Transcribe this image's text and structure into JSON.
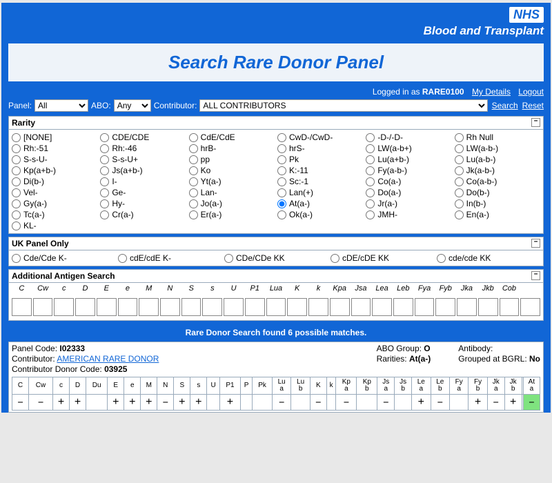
{
  "brand": {
    "logo": "NHS",
    "subtitle": "Blood and Transplant"
  },
  "page_title": "Search Rare Donor Panel",
  "user": {
    "prefix": "Logged in as ",
    "name": "RARE0100",
    "details": "My Details",
    "logout": "Logout"
  },
  "filter": {
    "panel_lbl": "Panel:",
    "panel_val": "All",
    "abo_lbl": "ABO:",
    "abo_val": "Any",
    "contrib_lbl": "Contributor:",
    "contrib_val": "ALL CONTRIBUTORS",
    "search": "Search",
    "reset": "Reset"
  },
  "rarity": {
    "title": "Rarity",
    "items": [
      "[NONE]",
      "CDE/CDE",
      "CdE/CdE",
      "CwD-/CwD-",
      "-D-/-D-",
      "Rh Null",
      "Rh:-51",
      "Rh:-46",
      "hrB-",
      "hrS-",
      "LW(a-b+)",
      "LW(a-b-)",
      "S-s-U-",
      "S-s-U+",
      "pp",
      "Pk",
      "Lu(a+b-)",
      "Lu(a-b-)",
      "Kp(a+b-)",
      "Js(a+b-)",
      "Ko",
      "K:-11",
      "Fy(a-b-)",
      "Jk(a-b-)",
      "Di(b-)",
      "I-",
      "Yt(a-)",
      "Sc:-1",
      "Co(a-)",
      "Co(a-b-)",
      "Vel-",
      "Ge-",
      "Lan-",
      "Lan(+)",
      "Do(a-)",
      "Do(b-)",
      "Gy(a-)",
      "Hy-",
      "Jo(a-)",
      "At(a-)",
      "Jr(a-)",
      "In(b-)",
      "Tc(a-)",
      "Cr(a-)",
      "Er(a-)",
      "Ok(a-)",
      "JMH-",
      "En(a-)",
      "KL-"
    ],
    "selected": "At(a-)"
  },
  "uk": {
    "title": "UK Panel Only",
    "items": [
      "Cde/Cde K-",
      "cdE/cdE K-",
      "CDe/CDe KK",
      "cDE/cDE KK",
      "cde/cde KK"
    ]
  },
  "antigen": {
    "title": "Additional Antigen Search",
    "cols": [
      "C",
      "Cw",
      "c",
      "D",
      "E",
      "e",
      "M",
      "N",
      "S",
      "s",
      "U",
      "P1",
      "Lua",
      "K",
      "k",
      "Kpa",
      "Jsa",
      "Lea",
      "Leb",
      "Fya",
      "Fyb",
      "Jka",
      "Jkb",
      "Cob",
      ""
    ]
  },
  "results": {
    "msg": "Rare Donor Search found 6 possible matches.",
    "entry": {
      "panel_code_lbl": "Panel Code: ",
      "panel_code": "I02333",
      "contributor_lbl": "Contributor: ",
      "contributor": "AMERICAN RARE DONOR",
      "cdonor_lbl": "Contributor Donor Code: ",
      "cdonor": "03925",
      "abo_lbl": "ABO Group: ",
      "abo": "O",
      "rar_lbl": "Rarities: ",
      "rar": "At(a-)",
      "ab_lbl": "Antibody:",
      "ab": "",
      "grp_lbl": "Grouped at BGRL: ",
      "grp": "No"
    },
    "cols": [
      "C",
      "Cw",
      "c",
      "D",
      "Du",
      "E",
      "e",
      "M",
      "N",
      "S",
      "s",
      "U",
      "P1",
      "P",
      "Pk",
      "Lu a",
      "Lu b",
      "K",
      "k",
      "Kp a",
      "Kp b",
      "Js a",
      "Js b",
      "Le a",
      "Le b",
      "Fy a",
      "Fy b",
      "Jk a",
      "Jk b",
      "",
      "At a"
    ],
    "vals": [
      "–",
      "–",
      "+",
      "+",
      "",
      "+",
      "+",
      "+",
      "–",
      "+",
      "+",
      "",
      "+",
      "",
      "",
      "–",
      "",
      "–",
      "",
      "–",
      "",
      "–",
      "",
      "+",
      "–",
      "",
      "+",
      "–",
      "+",
      "",
      "–"
    ],
    "hl_index": 30
  }
}
